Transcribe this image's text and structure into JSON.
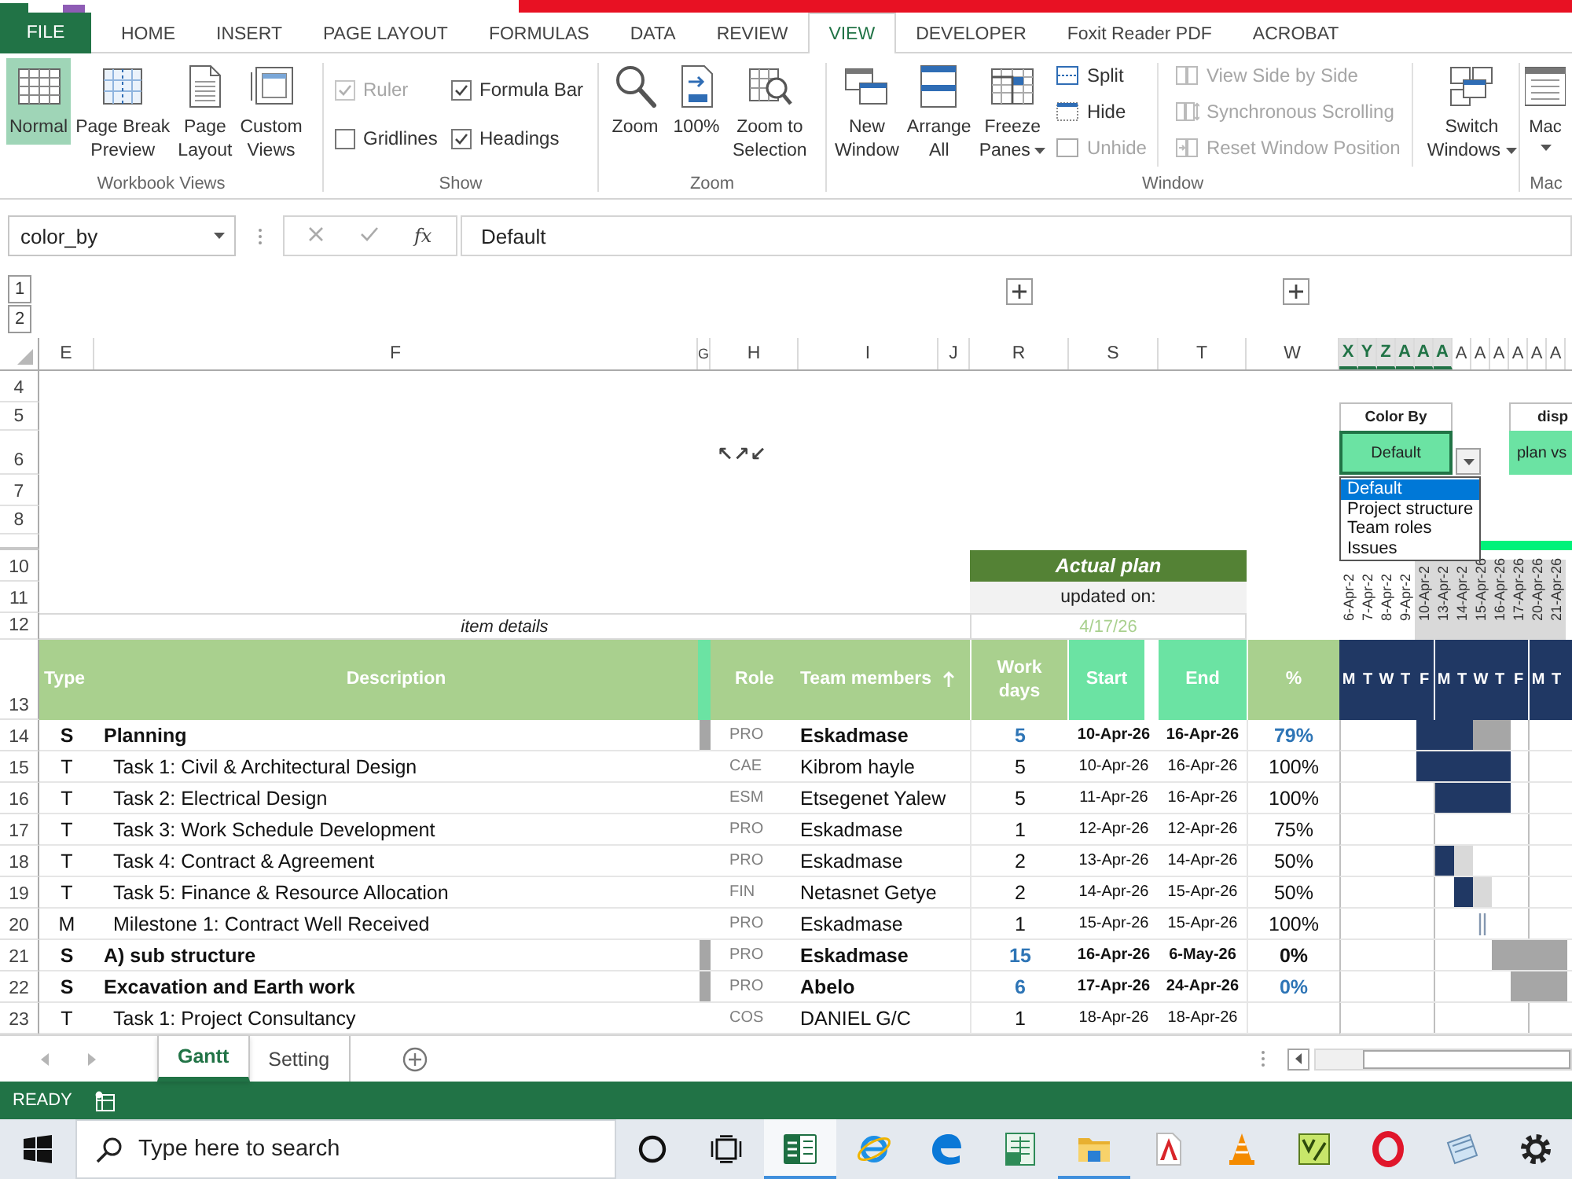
{
  "ribbon": {
    "tabs": [
      {
        "label": "FILE",
        "kind": "file",
        "selected": false
      },
      {
        "label": "HOME",
        "kind": "tab",
        "selected": false
      },
      {
        "label": "INSERT",
        "kind": "tab",
        "selected": false
      },
      {
        "label": "PAGE LAYOUT",
        "kind": "tab",
        "selected": false
      },
      {
        "label": "FORMULAS",
        "kind": "tab",
        "selected": false
      },
      {
        "label": "DATA",
        "kind": "tab",
        "selected": false
      },
      {
        "label": "REVIEW",
        "kind": "tab",
        "selected": false
      },
      {
        "label": "VIEW",
        "kind": "tab",
        "selected": true
      },
      {
        "label": "DEVELOPER",
        "kind": "tab",
        "selected": false
      },
      {
        "label": "Foxit Reader PDF",
        "kind": "tab",
        "selected": false
      },
      {
        "label": "ACROBAT",
        "kind": "tab",
        "selected": false
      }
    ],
    "workbook_views": {
      "label": "Workbook Views",
      "buttons": [
        {
          "lines": [
            "Normal"
          ],
          "selected": true
        },
        {
          "lines": [
            "Page Break",
            "Preview"
          ],
          "selected": false
        },
        {
          "lines": [
            "Page",
            "Layout"
          ],
          "selected": false
        },
        {
          "lines": [
            "Custom",
            "Views"
          ],
          "selected": false
        }
      ]
    },
    "show": {
      "label": "Show",
      "options": [
        {
          "label": "Ruler",
          "checked": true,
          "disabled": true
        },
        {
          "label": "Formula Bar",
          "checked": true,
          "disabled": false
        },
        {
          "label": "Gridlines",
          "checked": false,
          "disabled": false
        },
        {
          "label": "Headings",
          "checked": true,
          "disabled": false
        }
      ]
    },
    "zoom": {
      "label": "Zoom",
      "buttons": [
        {
          "lines": [
            "Zoom"
          ]
        },
        {
          "lines": [
            "100%"
          ]
        },
        {
          "lines": [
            "Zoom to",
            "Selection"
          ]
        }
      ]
    },
    "window": {
      "label": "Window",
      "large_buttons": [
        {
          "lines": [
            "New",
            "Window"
          ],
          "dropdown": false
        },
        {
          "lines": [
            "Arrange",
            "All"
          ],
          "dropdown": false
        },
        {
          "lines": [
            "Freeze",
            "Panes"
          ],
          "dropdown": true
        }
      ],
      "small_buttons": [
        {
          "label": "Split",
          "disabled": false
        },
        {
          "label": "Hide",
          "disabled": false
        },
        {
          "label": "Unhide",
          "disabled": true
        }
      ],
      "compare_buttons": [
        {
          "label": "View Side by Side",
          "disabled": true
        },
        {
          "label": "Synchronous Scrolling",
          "disabled": true
        },
        {
          "label": "Reset Window Position",
          "disabled": true
        }
      ],
      "switch": {
        "lines": [
          "Switch",
          "Windows"
        ],
        "dropdown": true
      }
    },
    "macros": {
      "label": "Mac",
      "button": "Mac",
      "dropdown": true
    }
  },
  "formula_bar": {
    "name_box": "color_by",
    "insert_function": "fx",
    "formula": "Default"
  },
  "outline": {
    "levels": [
      "1",
      "2"
    ]
  },
  "columns": [
    {
      "label": "E",
      "selected": false
    },
    {
      "label": "F",
      "selected": false
    },
    {
      "label": "G",
      "selected": false
    },
    {
      "label": "H",
      "selected": false
    },
    {
      "label": "I",
      "selected": false
    },
    {
      "label": "J",
      "selected": false
    },
    {
      "label": "R",
      "selected": false
    },
    {
      "label": "S",
      "selected": false
    },
    {
      "label": "T",
      "selected": false
    },
    {
      "label": "W",
      "selected": false
    }
  ],
  "timeline_columns": [
    {
      "label": "X",
      "selected": true
    },
    {
      "label": "Y",
      "selected": true
    },
    {
      "label": "Z",
      "selected": true
    },
    {
      "label": "A",
      "selected": true
    },
    {
      "label": "A",
      "selected": true
    },
    {
      "label": "A",
      "selected": true
    },
    {
      "label": "A",
      "selected": false
    },
    {
      "label": "A",
      "selected": false
    },
    {
      "label": "A",
      "selected": false
    },
    {
      "label": "A",
      "selected": false
    },
    {
      "label": "A",
      "selected": false
    },
    {
      "label": "A",
      "selected": false
    }
  ],
  "row_numbers": [
    "4",
    "5",
    "6",
    "7",
    "8",
    "10",
    "11",
    "12",
    "13"
  ],
  "outline_marks": "↖↗↙",
  "color_by": {
    "label": "Color By",
    "value": "Default",
    "options": [
      {
        "label": "Default",
        "selected": true
      },
      {
        "label": "Project structure",
        "selected": false
      },
      {
        "label": "Team roles",
        "selected": false
      },
      {
        "label": "Issues",
        "selected": false
      }
    ]
  },
  "display": {
    "label": "disp",
    "value": "plan vs"
  },
  "actual_plan": {
    "title": "Actual plan",
    "updated_label": "updated on:",
    "updated_date": "4/17/26"
  },
  "item_details": "item details",
  "timeline_dates": [
    {
      "label": "6-Apr-2",
      "shaded": false
    },
    {
      "label": "7-Apr-2",
      "shaded": false
    },
    {
      "label": "8-Apr-2",
      "shaded": false
    },
    {
      "label": "9-Apr-2",
      "shaded": false
    },
    {
      "label": "10-Apr-2",
      "shaded": true
    },
    {
      "label": "13-Apr-2",
      "shaded": true
    },
    {
      "label": "14-Apr-2",
      "shaded": true
    },
    {
      "label": "15-Apr-26",
      "shaded": true
    },
    {
      "label": "16-Apr-26",
      "shaded": true
    },
    {
      "label": "17-Apr-26",
      "shaded": true
    },
    {
      "label": "20-Apr-26",
      "shaded": true
    },
    {
      "label": "21-Apr-26",
      "shaded": true
    }
  ],
  "table": {
    "headers": {
      "type": "Type",
      "description": "Description",
      "role": "Role",
      "members": "Team members",
      "work_days": "Work days",
      "start": "Start",
      "end": "End",
      "percent": "%"
    },
    "weekdays": [
      "M",
      "T",
      "W",
      "T",
      "F",
      "M",
      "T",
      "W",
      "T",
      "F",
      "M",
      "T"
    ],
    "rows": [
      {
        "row": "14",
        "type": "S",
        "summary": true,
        "description": "Planning",
        "role": "PRO",
        "member": "Eskadmase",
        "work_days": "5",
        "start": "10-Apr-26",
        "end": "16-Apr-26",
        "percent": "79%",
        "percent_highlight": true,
        "timeline": [
          {
            "kind": "empty"
          },
          {
            "kind": "empty"
          },
          {
            "kind": "empty"
          },
          {
            "kind": "empty"
          },
          {
            "kind": "done"
          },
          {
            "kind": "done"
          },
          {
            "kind": "done"
          },
          {
            "kind": "left"
          },
          {
            "kind": "left"
          },
          {
            "kind": "empty"
          },
          {
            "kind": "empty"
          },
          {
            "kind": "empty"
          }
        ]
      },
      {
        "row": "15",
        "type": "T",
        "summary": false,
        "description": "Task 1: Civil & Architectural Design",
        "role": "CAE",
        "member": "Kibrom hayle",
        "work_days": "5",
        "start": "10-Apr-26",
        "end": "16-Apr-26",
        "percent": "100%",
        "percent_highlight": false,
        "timeline": [
          {
            "kind": "empty"
          },
          {
            "kind": "empty"
          },
          {
            "kind": "empty"
          },
          {
            "kind": "empty"
          },
          {
            "kind": "done"
          },
          {
            "kind": "done"
          },
          {
            "kind": "done"
          },
          {
            "kind": "done"
          },
          {
            "kind": "done"
          },
          {
            "kind": "empty"
          },
          {
            "kind": "empty"
          },
          {
            "kind": "empty"
          }
        ]
      },
      {
        "row": "16",
        "type": "T",
        "summary": false,
        "description": "Task 2: Electrical Design",
        "role": "ESM",
        "member": "Etsegenet Yalew",
        "work_days": "5",
        "start": "11-Apr-26",
        "end": "16-Apr-26",
        "percent": "100%",
        "percent_highlight": false,
        "timeline": [
          {
            "kind": "empty"
          },
          {
            "kind": "empty"
          },
          {
            "kind": "empty"
          },
          {
            "kind": "empty"
          },
          {
            "kind": "empty"
          },
          {
            "kind": "done"
          },
          {
            "kind": "done"
          },
          {
            "kind": "done"
          },
          {
            "kind": "done"
          },
          {
            "kind": "empty"
          },
          {
            "kind": "empty"
          },
          {
            "kind": "empty"
          }
        ]
      },
      {
        "row": "17",
        "type": "T",
        "summary": false,
        "description": "Task 3: Work Schedule Development",
        "role": "PRO",
        "member": "Eskadmase",
        "work_days": "1",
        "start": "12-Apr-26",
        "end": "12-Apr-26",
        "percent": "75%",
        "percent_highlight": false,
        "timeline": [
          {
            "kind": "empty"
          },
          {
            "kind": "empty"
          },
          {
            "kind": "empty"
          },
          {
            "kind": "empty"
          },
          {
            "kind": "empty"
          },
          {
            "kind": "empty"
          },
          {
            "kind": "empty"
          },
          {
            "kind": "empty"
          },
          {
            "kind": "empty"
          },
          {
            "kind": "empty"
          },
          {
            "kind": "empty"
          },
          {
            "kind": "empty"
          }
        ]
      },
      {
        "row": "18",
        "type": "T",
        "summary": false,
        "description": "Task 4: Contract & Agreement",
        "role": "PRO",
        "member": "Eskadmase",
        "work_days": "2",
        "start": "13-Apr-26",
        "end": "14-Apr-26",
        "percent": "50%",
        "percent_highlight": false,
        "timeline": [
          {
            "kind": "empty"
          },
          {
            "kind": "empty"
          },
          {
            "kind": "empty"
          },
          {
            "kind": "empty"
          },
          {
            "kind": "empty"
          },
          {
            "kind": "done"
          },
          {
            "kind": "pending"
          },
          {
            "kind": "empty"
          },
          {
            "kind": "empty"
          },
          {
            "kind": "empty"
          },
          {
            "kind": "empty"
          },
          {
            "kind": "empty"
          }
        ]
      },
      {
        "row": "19",
        "type": "T",
        "summary": false,
        "description": "Task 5: Finance & Resource Allocation",
        "role": "FIN",
        "member": "Netasnet Getye",
        "work_days": "2",
        "start": "14-Apr-26",
        "end": "15-Apr-26",
        "percent": "50%",
        "percent_highlight": false,
        "timeline": [
          {
            "kind": "empty"
          },
          {
            "kind": "empty"
          },
          {
            "kind": "empty"
          },
          {
            "kind": "empty"
          },
          {
            "kind": "empty"
          },
          {
            "kind": "empty"
          },
          {
            "kind": "done"
          },
          {
            "kind": "pending"
          },
          {
            "kind": "empty"
          },
          {
            "kind": "empty"
          },
          {
            "kind": "empty"
          },
          {
            "kind": "empty"
          }
        ]
      },
      {
        "row": "20",
        "type": "M",
        "summary": false,
        "description": "Milestone 1: Contract Well Received",
        "role": "PRO",
        "member": "Eskadmase",
        "work_days": "1",
        "start": "15-Apr-26",
        "end": "15-Apr-26",
        "percent": "100%",
        "percent_highlight": false,
        "timeline": [
          {
            "kind": "empty"
          },
          {
            "kind": "empty"
          },
          {
            "kind": "empty"
          },
          {
            "kind": "empty"
          },
          {
            "kind": "empty"
          },
          {
            "kind": "empty"
          },
          {
            "kind": "empty"
          },
          {
            "kind": "milestone"
          },
          {
            "kind": "empty"
          },
          {
            "kind": "empty"
          },
          {
            "kind": "empty"
          },
          {
            "kind": "empty"
          }
        ]
      },
      {
        "row": "21",
        "type": "S",
        "summary": true,
        "description": "A) sub structure",
        "role": "PRO",
        "member": "Eskadmase",
        "work_days": "15",
        "start": "16-Apr-26",
        "end": "6-May-26",
        "percent": "0%",
        "percent_highlight": false,
        "timeline": [
          {
            "kind": "empty"
          },
          {
            "kind": "empty"
          },
          {
            "kind": "empty"
          },
          {
            "kind": "empty"
          },
          {
            "kind": "empty"
          },
          {
            "kind": "empty"
          },
          {
            "kind": "empty"
          },
          {
            "kind": "empty"
          },
          {
            "kind": "left"
          },
          {
            "kind": "left"
          },
          {
            "kind": "left"
          },
          {
            "kind": "left"
          }
        ]
      },
      {
        "row": "22",
        "type": "S",
        "summary": true,
        "description": "Excavation and Earth work",
        "role": "PRO",
        "member": "Abelo",
        "work_days": "6",
        "start": "17-Apr-26",
        "end": "24-Apr-26",
        "percent": "0%",
        "percent_highlight": true,
        "timeline": [
          {
            "kind": "empty"
          },
          {
            "kind": "empty"
          },
          {
            "kind": "empty"
          },
          {
            "kind": "empty"
          },
          {
            "kind": "empty"
          },
          {
            "kind": "empty"
          },
          {
            "kind": "empty"
          },
          {
            "kind": "empty"
          },
          {
            "kind": "empty"
          },
          {
            "kind": "left"
          },
          {
            "kind": "left"
          },
          {
            "kind": "left"
          }
        ]
      },
      {
        "row": "23",
        "type": "T",
        "summary": false,
        "description": "Task 1: Project Consultancy",
        "role": "COS",
        "member": "DANIEL G/C",
        "work_days": "1",
        "start": "18-Apr-26",
        "end": "18-Apr-26",
        "timeline": [
          {
            "kind": "empty"
          },
          {
            "kind": "empty"
          },
          {
            "kind": "empty"
          },
          {
            "kind": "empty"
          },
          {
            "kind": "empty"
          },
          {
            "kind": "empty"
          },
          {
            "kind": "empty"
          },
          {
            "kind": "empty"
          },
          {
            "kind": "empty"
          },
          {
            "kind": "empty"
          },
          {
            "kind": "empty"
          },
          {
            "kind": "empty"
          }
        ]
      }
    ]
  },
  "sheet_tabs": [
    {
      "label": "Gantt",
      "selected": true
    },
    {
      "label": "Setting",
      "selected": false
    }
  ],
  "status_bar": {
    "mode": "READY"
  },
  "taskbar": {
    "search": {
      "placeholder": "Type here to search"
    },
    "apps": [
      {
        "running": true,
        "selected": true
      },
      {
        "running": false,
        "selected": false
      },
      {
        "running": false,
        "selected": false
      },
      {
        "running": false,
        "selected": false
      },
      {
        "running": true,
        "selected": false
      },
      {
        "running": false,
        "selected": false
      },
      {
        "running": false,
        "selected": false
      },
      {
        "running": false,
        "selected": false
      },
      {
        "running": false,
        "selected": false
      },
      {
        "running": false,
        "selected": false
      },
      {
        "running": false,
        "selected": false
      }
    ]
  }
}
